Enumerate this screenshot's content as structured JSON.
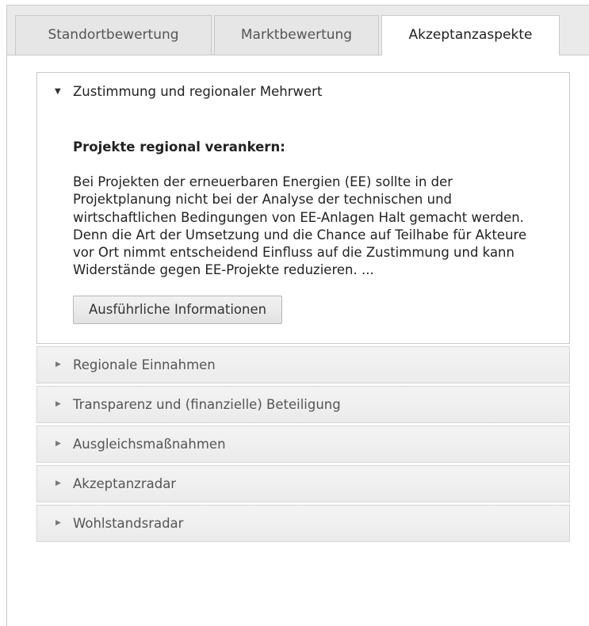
{
  "tabs": [
    {
      "label": "Standortbewertung",
      "active": false
    },
    {
      "label": "Marktbewertung",
      "active": false
    },
    {
      "label": "Akzeptanzaspekte",
      "active": true
    }
  ],
  "accordion": {
    "open_section": {
      "title": "Zustimmung und regionaler Mehrwert",
      "heading": "Projekte regional verankern:",
      "body": "Bei Projekten der erneuerbaren Energien (EE) sollte in der Projektplanung nicht bei der Analyse der technischen und wirtschaftlichen Bedingungen von EE-Anlagen Halt gemacht werden. Denn die Art der Umsetzung und die Chance auf Teilhabe für Akteure vor Ort nimmt entscheidend Einfluss auf die Zustimmung und kann Widerstände gegen EE-Projekte reduzieren. ...",
      "button_label": "Ausführliche Informationen"
    },
    "collapsed_sections": [
      "Regionale Einnahmen",
      "Transparenz und (finanzielle) Beteiligung",
      "Ausgleichsmaßnahmen",
      "Akzeptanzradar",
      "Wohlstandsradar"
    ]
  },
  "icons": {
    "expanded": "caret-down-icon",
    "collapsed": "caret-right-icon"
  }
}
